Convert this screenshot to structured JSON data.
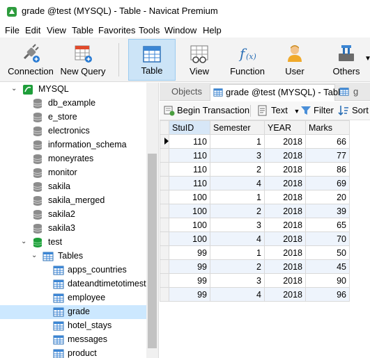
{
  "window": {
    "title": "grade @test (MYSQL) - Table - Navicat Premium"
  },
  "menu": [
    "File",
    "Edit",
    "View",
    "Table",
    "Favorites",
    "Tools",
    "Window",
    "Help"
  ],
  "toolbar": {
    "connection": "Connection",
    "new_query": "New Query",
    "table": "Table",
    "view": "View",
    "function": "Function",
    "user": "User",
    "others": "Others"
  },
  "tree": {
    "connection": "MYSQL",
    "databases": [
      "db_example",
      "e_store",
      "electronics",
      "information_schema",
      "moneyrates",
      "monitor",
      "sakila",
      "sakila_merged",
      "sakila2",
      "sakila3"
    ],
    "open_db": "test",
    "tables_folder": "Tables",
    "tables": [
      "apps_countries",
      "dateandtimetotimest",
      "employee",
      "grade",
      "hotel_stays",
      "messages",
      "product"
    ],
    "selected": "grade"
  },
  "tabs": {
    "objects": "Objects",
    "active": "grade @test (MYSQL) - Table",
    "next_prefix": "g"
  },
  "subtoolbar": {
    "begin_transaction": "Begin Transaction",
    "text": "Text",
    "filter": "Filter",
    "sort": "Sort"
  },
  "grid": {
    "columns": [
      "StuID",
      "Semester",
      "YEAR",
      "Marks"
    ],
    "rows": [
      [
        "110",
        "1",
        "2018",
        "66"
      ],
      [
        "110",
        "3",
        "2018",
        "77"
      ],
      [
        "110",
        "2",
        "2018",
        "86"
      ],
      [
        "110",
        "4",
        "2018",
        "69"
      ],
      [
        "100",
        "1",
        "2018",
        "20"
      ],
      [
        "100",
        "2",
        "2018",
        "39"
      ],
      [
        "100",
        "3",
        "2018",
        "65"
      ],
      [
        "100",
        "4",
        "2018",
        "70"
      ],
      [
        "99",
        "1",
        "2018",
        "50"
      ],
      [
        "99",
        "2",
        "2018",
        "45"
      ],
      [
        "99",
        "3",
        "2018",
        "90"
      ],
      [
        "99",
        "4",
        "2018",
        "96"
      ]
    ]
  },
  "colors": {
    "selection": "#cce8ff",
    "active_toolbar": "#cce4f7",
    "alt_row": "#eef4fc",
    "db_green": "#1e9e3a"
  }
}
